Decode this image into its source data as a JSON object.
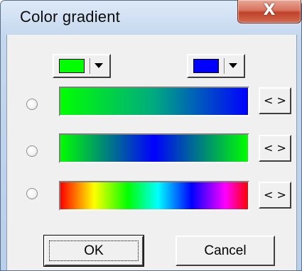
{
  "window": {
    "title": "Color gradient",
    "close_symbol": "X"
  },
  "colors": {
    "start_color": "#00ff00",
    "end_color": "#0000ff"
  },
  "gradients": [
    {
      "name": "linear-start-to-end",
      "selected": false,
      "swap_label": "< >"
    },
    {
      "name": "start-end-start",
      "selected": false,
      "swap_label": "< >"
    },
    {
      "name": "rainbow-spectrum",
      "selected": false,
      "swap_label": "< >"
    }
  ],
  "buttons": {
    "ok_label": "OK",
    "cancel_label": "Cancel"
  },
  "icons": {
    "close": "close-icon",
    "dropdown": "chevron-down-icon"
  }
}
